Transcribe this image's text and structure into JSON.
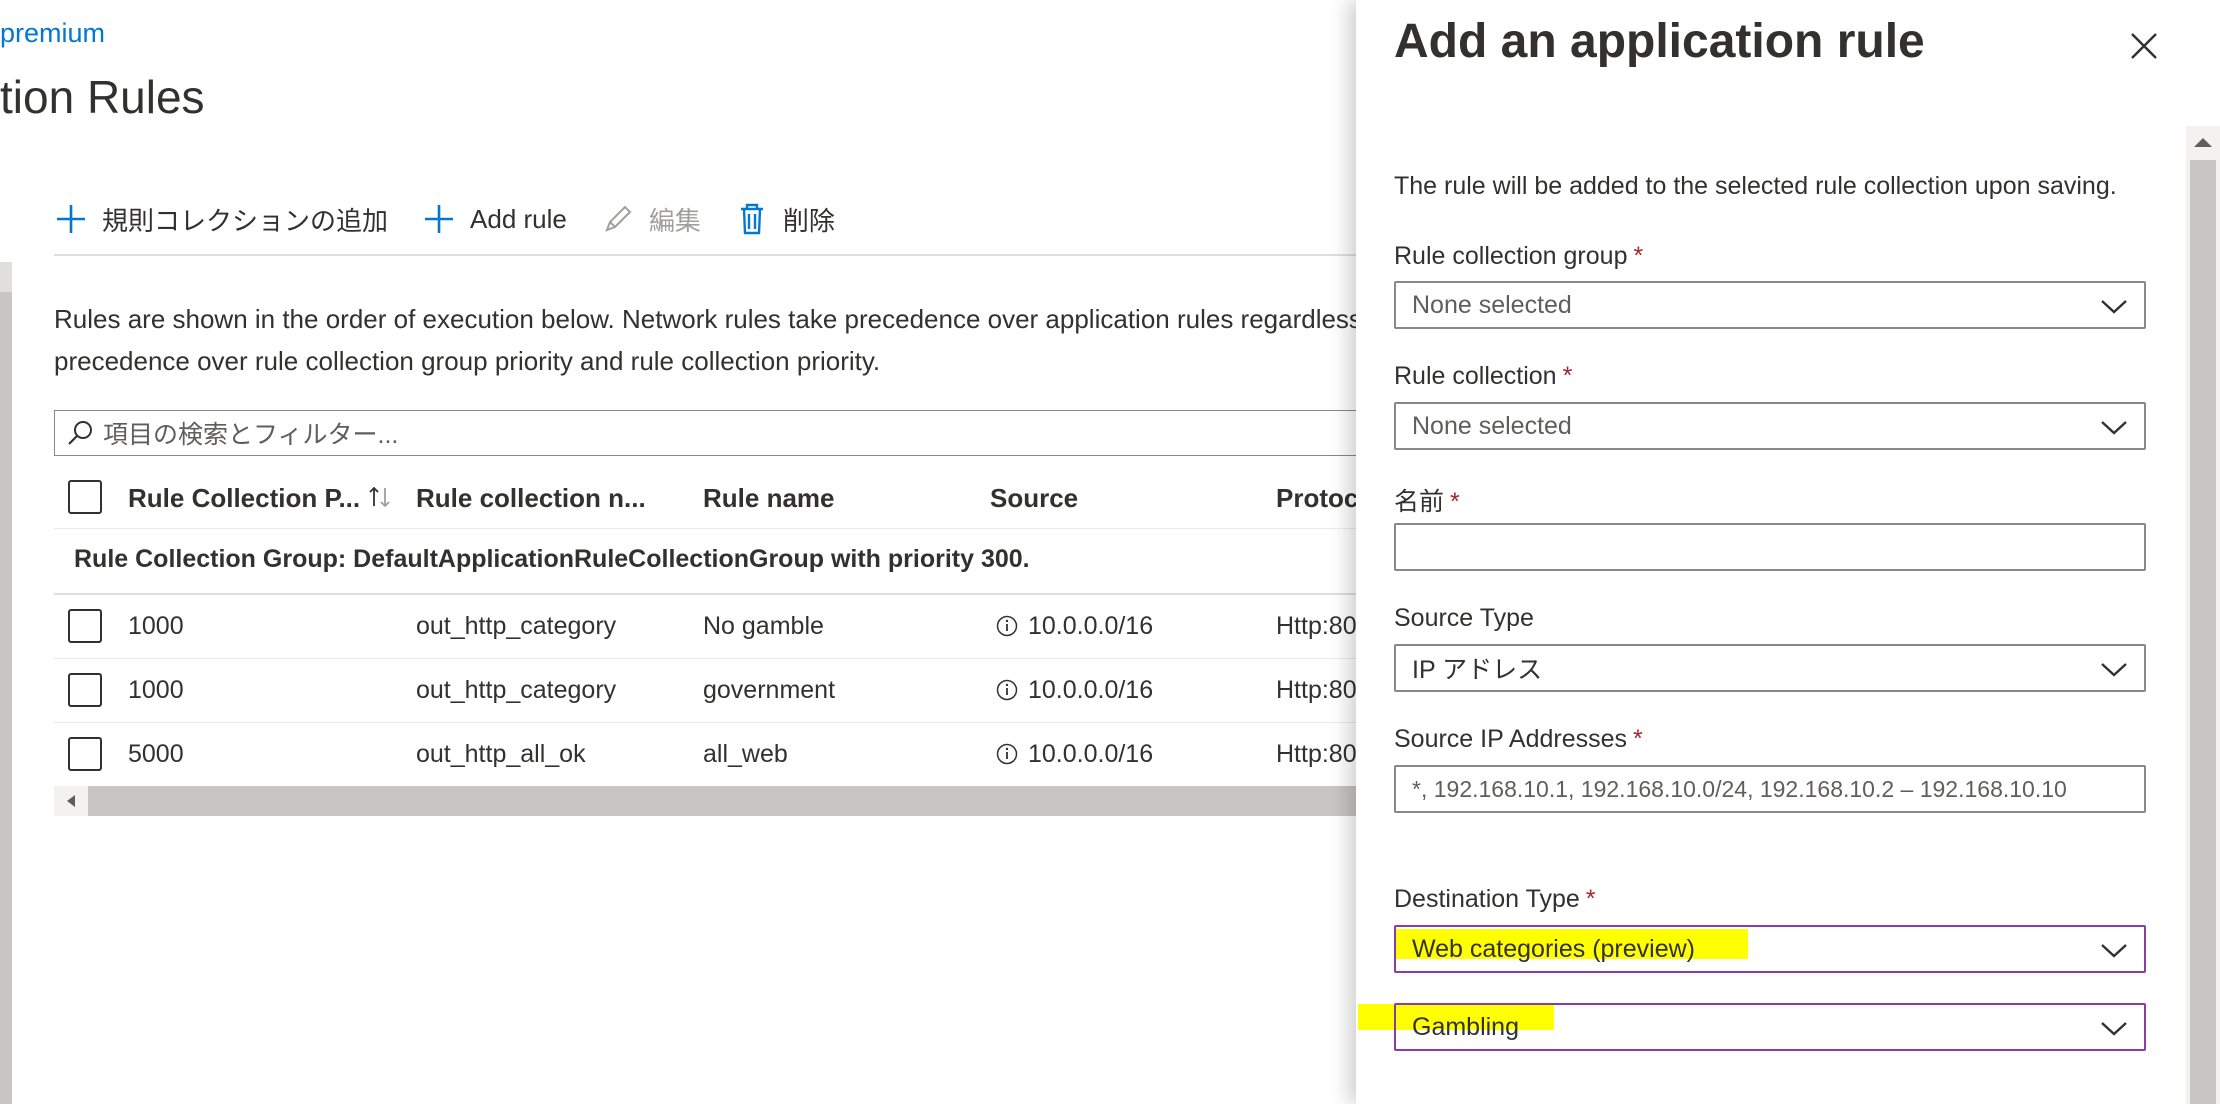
{
  "breadcrumb": "premium",
  "page_title": "tion Rules",
  "toolbar": {
    "add_collection_label": "規則コレクションの追加",
    "add_rule_label": "Add rule",
    "edit_label": "編集",
    "delete_label": "削除"
  },
  "description": {
    "line1": "Rules are shown in the order of execution below. Network rules take precedence over application rules regardless",
    "line2": "precedence over rule collection group priority and rule collection priority."
  },
  "search": {
    "placeholder": "項目の検索とフィルター..."
  },
  "table": {
    "headers": {
      "priority": "Rule Collection P...",
      "collection_name": "Rule collection n...",
      "rule_name": "Rule name",
      "source": "Source",
      "protocol": "Protoc"
    },
    "group_label": "Rule Collection Group: DefaultApplicationRuleCollectionGroup with priority 300.",
    "rows": [
      {
        "priority": "1000",
        "collection": "out_http_category",
        "rule": "No gamble",
        "source": "10.0.0.0/16",
        "protocol": "Http:80"
      },
      {
        "priority": "1000",
        "collection": "out_http_category",
        "rule": "government",
        "source": "10.0.0.0/16",
        "protocol": "Http:80"
      },
      {
        "priority": "5000",
        "collection": "out_http_all_ok",
        "rule": "all_web",
        "source": "10.0.0.0/16",
        "protocol": "Http:80"
      }
    ]
  },
  "panel": {
    "title": "Add an application rule",
    "intro": "The rule will be added to the selected rule collection upon saving.",
    "required_marker": "*",
    "fields": {
      "rule_collection_group": {
        "label": "Rule collection group",
        "value": "None selected"
      },
      "rule_collection": {
        "label": "Rule collection",
        "value": "None selected"
      },
      "name": {
        "label": "名前",
        "value": ""
      },
      "source_type": {
        "label": "Source Type",
        "value": "IP アドレス"
      },
      "source_ip": {
        "label": "Source IP Addresses",
        "placeholder": "*, 192.168.10.1, 192.168.10.0/24, 192.168.10.2 – 192.168.10.10"
      },
      "destination_type": {
        "label": "Destination Type",
        "value": "Web categories (preview)"
      },
      "destination_category": {
        "value": "Gambling"
      }
    }
  },
  "colors": {
    "link": "#0078d4",
    "required": "#a4262c",
    "focus_border": "#8a3ca8",
    "highlight": "#ffff00"
  },
  "icons": [
    "plus-icon",
    "pencil-icon",
    "trash-icon",
    "search-icon",
    "info-icon",
    "close-icon",
    "chevron-down-icon",
    "sort-arrows-icon",
    "scroll-left-icon",
    "scroll-up-icon"
  ]
}
